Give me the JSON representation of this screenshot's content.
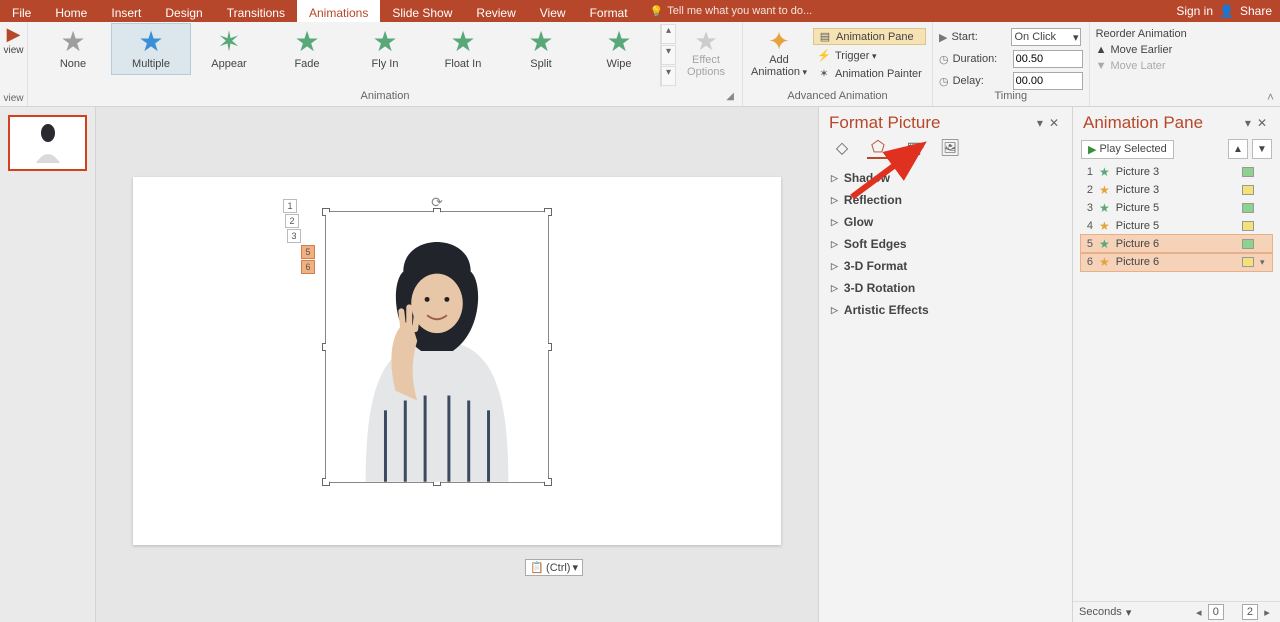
{
  "menubar": {
    "tabs": [
      "File",
      "Home",
      "Insert",
      "Design",
      "Transitions",
      "Animations",
      "Slide Show",
      "Review",
      "View",
      "Format"
    ],
    "active": "Animations",
    "tellme": "Tell me what you want to do...",
    "signin": "Sign in",
    "share": "Share"
  },
  "ribbon": {
    "preview": "view",
    "preview2": "view",
    "animationGroup": "Animation",
    "gallery": [
      {
        "label": "None",
        "color": "gray"
      },
      {
        "label": "Multiple",
        "color": "blue"
      },
      {
        "label": "Appear",
        "color": "green"
      },
      {
        "label": "Fade",
        "color": "green"
      },
      {
        "label": "Fly In",
        "color": "green"
      },
      {
        "label": "Float In",
        "color": "green"
      },
      {
        "label": "Split",
        "color": "green"
      },
      {
        "label": "Wipe",
        "color": "green"
      }
    ],
    "effectOptions": "Effect\nOptions",
    "addAnimation": "Add\nAnimation",
    "animationPaneBtn": "Animation Pane",
    "trigger": "Trigger",
    "animationPainter": "Animation Painter",
    "advGroup": "Advanced Animation",
    "timing": {
      "startLabel": "Start:",
      "startValue": "On Click",
      "durationLabel": "Duration:",
      "durationValue": "00.50",
      "delayLabel": "Delay:",
      "delayValue": "00.00",
      "group": "Timing"
    },
    "reorder": {
      "header": "Reorder Animation",
      "earlier": "Move Earlier",
      "later": "Move Later"
    }
  },
  "slide": {
    "tags": [
      "1",
      "2",
      "3",
      "5",
      "6"
    ],
    "ctrl": "(Ctrl)"
  },
  "formatPicture": {
    "title": "Format Picture",
    "items": [
      "Shadow",
      "Reflection",
      "Glow",
      "Soft Edges",
      "3-D Format",
      "3-D Rotation",
      "Artistic Effects"
    ]
  },
  "animationPane": {
    "title": "Animation Pane",
    "play": "Play Selected",
    "items": [
      {
        "n": "1",
        "name": "Picture 3",
        "star": "green",
        "bar": "g",
        "sel": false
      },
      {
        "n": "2",
        "name": "Picture 3",
        "star": "orange",
        "bar": "y",
        "sel": false
      },
      {
        "n": "3",
        "name": "Picture 5",
        "star": "green",
        "bar": "g",
        "sel": false
      },
      {
        "n": "4",
        "name": "Picture 5",
        "star": "orange",
        "bar": "y",
        "sel": false
      },
      {
        "n": "5",
        "name": "Picture 6",
        "star": "green",
        "bar": "g",
        "sel": true
      },
      {
        "n": "6",
        "name": "Picture 6",
        "star": "orange",
        "bar": "y",
        "sel": true
      }
    ],
    "footer": {
      "unit": "Seconds",
      "zoom0": "0",
      "zoom2": "2"
    }
  }
}
